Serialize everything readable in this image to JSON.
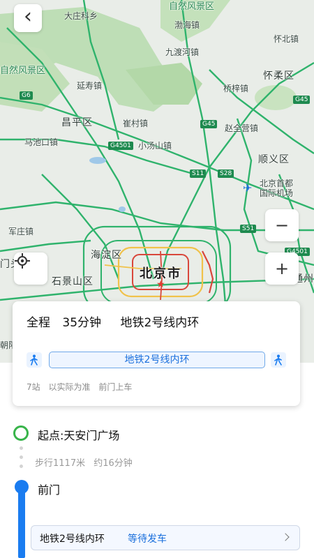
{
  "map": {
    "labels": {
      "daxiang": "大庄科乡",
      "scenic_top": "自然风景区",
      "bohai": "渤海镇",
      "huaibei": "怀北镇",
      "jiuduhe": "九渡河镇",
      "huairou": "怀柔区",
      "scenic_left": "自然风景区",
      "yanshou": "延寿镇",
      "qiaozi": "桥梓镇",
      "changping": "昌平区",
      "cuicun": "崔村镇",
      "zhaoquanying": "赵全营镇",
      "machikou": "马池口镇",
      "xiaotangshan": "小汤山镇",
      "shunyi": "顺义区",
      "airport": "北京首都\n国际机场",
      "junzhuang": "军庄镇",
      "haidian": "海淀区",
      "mentou": "门头沟区",
      "shijingshan": "石景山区",
      "beijing": "北京市",
      "tongzhou": "通州",
      "fengtai": "朝阳"
    },
    "road_shields": [
      "G6",
      "G45",
      "G45",
      "G4501",
      "S11",
      "S28",
      "S51",
      "G4501"
    ]
  },
  "controls": {
    "back": "‹",
    "zoom_in": "+",
    "zoom_out": "−"
  },
  "route": {
    "total_label": "全程",
    "duration": "35分钟",
    "line_summary": "地铁2号线内环",
    "line_pill": "地铁2号线内环",
    "stops": "7站",
    "note": "以实际为准",
    "board": "前门上车"
  },
  "steps": {
    "start": "起点:天安门广场",
    "walk_distance": "步行1117米",
    "walk_time": "约16分钟",
    "station": "前门",
    "subway_line": "地铁2号线内环",
    "subway_status": "等待发车"
  },
  "colors": {
    "accent": "#1a7cf0",
    "start_green": "#38b44a",
    "road_green": "#2fb36c",
    "road_yellow": "#f0c24a",
    "road_red": "#d9473b"
  }
}
